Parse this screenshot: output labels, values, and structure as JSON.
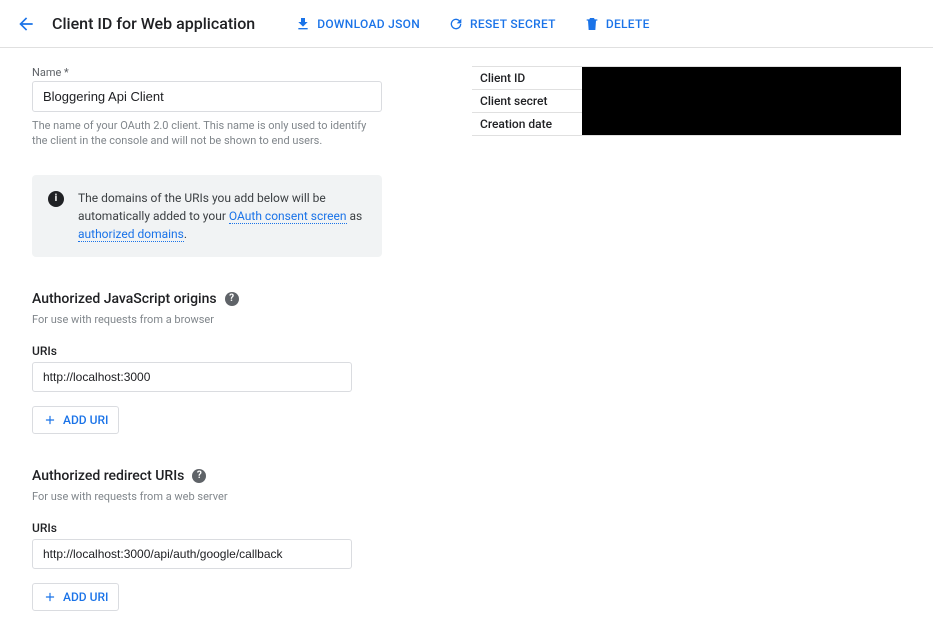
{
  "header": {
    "title": "Client ID for Web application",
    "download": "DOWNLOAD JSON",
    "reset": "RESET SECRET",
    "delete": "DELETE"
  },
  "name_field": {
    "label": "Name *",
    "value": "Bloggering Api Client",
    "help": "The name of your OAuth 2.0 client. This name is only used to identify the client in the console and will not be shown to end users."
  },
  "info_box": {
    "prefix": "The domains of the URIs you add below will be automatically added to your ",
    "oauth_link": "OAuth consent screen",
    "mid": " as ",
    "auth_link": "authorized domains",
    "suffix": "."
  },
  "js_origins": {
    "title": "Authorized JavaScript origins",
    "sub": "For use with requests from a browser",
    "uris_label": "URIs",
    "uris": [
      "http://localhost:3000"
    ],
    "add": "ADD URI"
  },
  "redirect_uris": {
    "title": "Authorized redirect URIs",
    "sub": "For use with requests from a web server",
    "uris_label": "URIs",
    "uris": [
      "http://localhost:3000/api/auth/google/callback"
    ],
    "add": "ADD URI"
  },
  "details": {
    "client_id_label": "Client ID",
    "client_secret_label": "Client secret",
    "creation_date_label": "Creation date"
  }
}
